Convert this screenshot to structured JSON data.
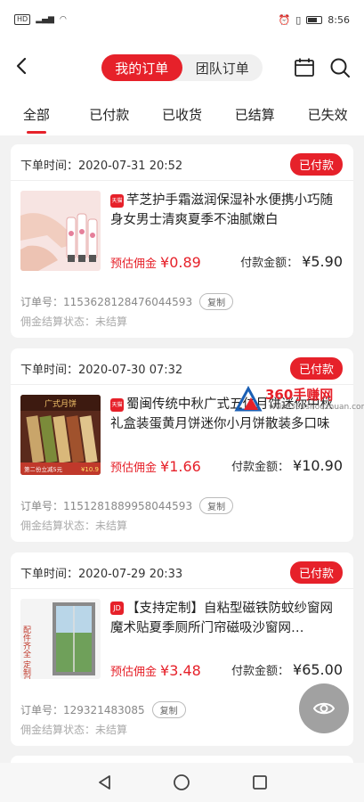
{
  "status_bar": {
    "left": "HD",
    "time": "8:56"
  },
  "header": {
    "seg_mine": "我的订单",
    "seg_team": "团队订单"
  },
  "tabs": [
    "全部",
    "已付款",
    "已收货",
    "已结算",
    "已失效"
  ],
  "labels": {
    "order_time": "下单时间：",
    "commission": "预估佣金",
    "paid_amount": "付款金额：",
    "order_no": "订单号：",
    "copy": "复制",
    "settle_status": "佣金结算状态："
  },
  "orders": [
    {
      "time": "2020-07-31 20:52",
      "status": "已付款",
      "shop_badge": "天猫",
      "title": "芊芝护手霜滋润保湿补水便携小巧随身女男士清爽夏季不油腻嫩白",
      "commission": "¥0.89",
      "paid": "¥5.90",
      "order_no": "1153628128476044593",
      "settle": "未结算"
    },
    {
      "time": "2020-07-30 07:32",
      "status": "已付款",
      "shop_badge": "天猫",
      "title": "蜀闽传统中秋广式五仁月饼迷你中秋礼盒装蛋黄月饼迷你小月饼散装多口味",
      "commission": "¥1.66",
      "paid": "¥10.90",
      "order_no": "1151281889958044593",
      "settle": "未结算",
      "thumb_text_top": "广式月饼",
      "thumb_text_bottom": "第二份立减5元",
      "thumb_price": "¥10.9"
    },
    {
      "time": "2020-07-29 20:33",
      "status": "已付款",
      "shop_badge": "JD",
      "title": "【支持定制】自粘型磁铁防蚊纱窗网魔术贴夏季厕所门帘磁吸沙窗网…",
      "commission": "¥3.48",
      "paid": "¥65.00",
      "order_no": "129321483085",
      "settle": "未结算",
      "thumb_text": "配件齐全 定制尺寸"
    }
  ],
  "watermark": {
    "brand": "360手赚网",
    "url": "www.360shouzhuan.com"
  },
  "colors": {
    "accent": "#e6212a"
  }
}
